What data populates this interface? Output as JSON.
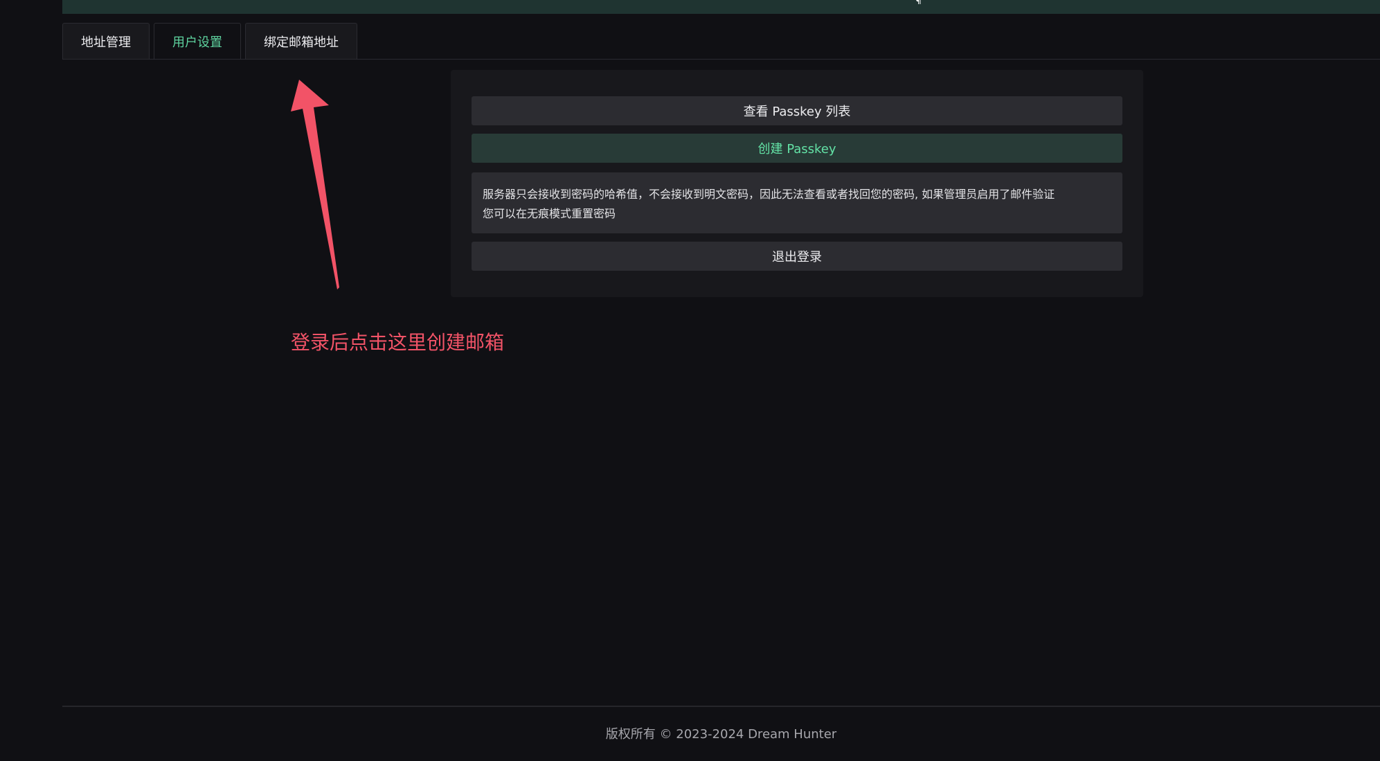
{
  "header": {
    "glyph": "¶"
  },
  "tabs": [
    {
      "label": "地址管理"
    },
    {
      "label": "用户设置"
    },
    {
      "label": "绑定邮箱地址"
    }
  ],
  "active_tab": "用户设置",
  "settings": {
    "view_passkey_label": "查看 Passkey 列表",
    "create_passkey_label": "创建 Passkey",
    "notice_line1": "服务器只会接收到密码的哈希值，不会接收到明文密码，因此无法查看或者找回您的密码, 如果管理员启用了邮件验证",
    "notice_line2": "您可以在无痕模式重置密码",
    "logout_label": "退出登录"
  },
  "annotation": {
    "text": "登录后点击这里创建邮箱",
    "color": "#f25367"
  },
  "footer": {
    "copyright": "版权所有 © 2023-2024 Dream Hunter"
  },
  "colors": {
    "accent_green": "#63e2a6",
    "background": "#101014",
    "header_bar": "#1f3431"
  }
}
